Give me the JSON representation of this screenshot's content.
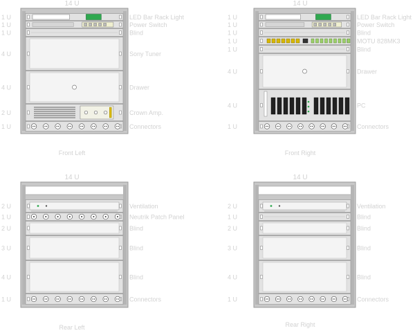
{
  "racks": [
    {
      "id": "front-left",
      "title": "14 U",
      "caption": "Front Left",
      "units": [
        {
          "size": "1 U",
          "label": "LED Bar Rack Light",
          "type": "led"
        },
        {
          "size": "1 U",
          "label": "Power Switch",
          "type": "power"
        },
        {
          "size": "1 U",
          "label": "Blind",
          "type": "blind-thin"
        },
        {
          "size": "4 U",
          "label": "Sony Tuner",
          "type": "tuner"
        },
        {
          "size": "4 U",
          "label": "Drawer",
          "type": "drawer"
        },
        {
          "size": "2 U",
          "label": "Crown Amp.",
          "type": "amp"
        },
        {
          "size": "1 U",
          "label": "Connectors",
          "type": "outlets"
        }
      ]
    },
    {
      "id": "front-right",
      "title": "14 U",
      "caption": "Front Right",
      "units": [
        {
          "size": "1 U",
          "label": "LED Bar Rack Light",
          "type": "led"
        },
        {
          "size": "1 U",
          "label": "Power Switch",
          "type": "power"
        },
        {
          "size": "1 U",
          "label": "Blind",
          "type": "blind-thin"
        },
        {
          "size": "1 U",
          "label": "MOTU 828MK3",
          "type": "motu"
        },
        {
          "size": "1 U",
          "label": "Blind",
          "type": "blind-thin"
        },
        {
          "size": "4 U",
          "label": "Drawer",
          "type": "drawer"
        },
        {
          "size": "4 U",
          "label": "PC",
          "type": "pc"
        },
        {
          "size": "1 U",
          "label": "Connectors",
          "type": "outlets"
        }
      ]
    },
    {
      "id": "rear-left",
      "title": "14 U",
      "caption": "Rear Left",
      "units": [
        {
          "size": "2 U",
          "label": "Ventilation",
          "type": "vent"
        },
        {
          "size": "1 U",
          "label": "Neutrik Patch Panel",
          "type": "patch"
        },
        {
          "size": "2 U",
          "label": "Blind",
          "type": "blind"
        },
        {
          "size": "3 U",
          "label": "Blind",
          "type": "blind"
        },
        {
          "size": "4 U",
          "label": "Blind",
          "type": "blind"
        },
        {
          "size": "1 U",
          "label": "Connectors",
          "type": "outlets"
        }
      ]
    },
    {
      "id": "rear-right",
      "title": "14 U",
      "caption": "Rear Right",
      "units": [
        {
          "size": "2 U",
          "label": "Ventilation",
          "type": "vent"
        },
        {
          "size": "1 U",
          "label": "Blind",
          "type": "blind-thin"
        },
        {
          "size": "2 U",
          "label": "Blind",
          "type": "blind"
        },
        {
          "size": "3 U",
          "label": "Blind",
          "type": "blind"
        },
        {
          "size": "4 U",
          "label": "Blind",
          "type": "blind"
        },
        {
          "size": "1 U",
          "label": "Connectors",
          "type": "outlets"
        }
      ]
    }
  ],
  "colors": {
    "frame": "#c8c8c8",
    "frame_dark": "#9a9a9a",
    "panel": "#e2e2e2",
    "panel_light": "#f4f4f4",
    "text": "#d2d2d2",
    "led_green": "#2fa84f",
    "motu_yellow": "#d8b800",
    "pc_slot": "#222222"
  }
}
